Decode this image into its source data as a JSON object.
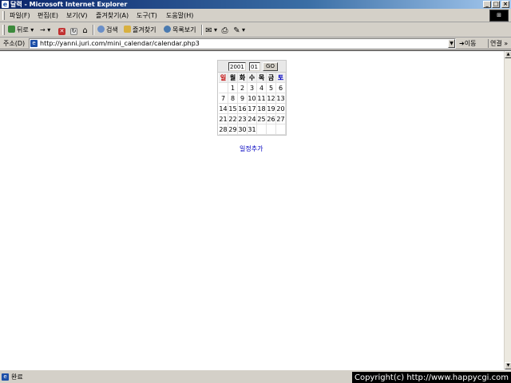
{
  "window": {
    "title": "달력 - Microsoft Internet Explorer",
    "icon": "ie-icon",
    "controls": {
      "minimize": "_",
      "maximize": "□",
      "close": "×"
    }
  },
  "menu": {
    "items": [
      "파일(F)",
      "편집(E)",
      "보기(V)",
      "즐겨찾기(A)",
      "도구(T)",
      "도움말(H)"
    ]
  },
  "toolbar": {
    "back": "뒤로",
    "forward": "→",
    "stop": "✕",
    "refresh": "↻",
    "home": "⌂",
    "search": "검색",
    "favorites": "즐겨찾기",
    "history": "목록보기",
    "mail": "✉",
    "print": "⎙",
    "edit": "✎"
  },
  "address": {
    "label": "주소(D)",
    "url": "http://yanni.juri.com/mini_calendar/calendar.php3",
    "go_label": "이동",
    "links_label": "연결 »"
  },
  "calendar": {
    "year": "2001",
    "month": "01",
    "go_label": "GO",
    "weekdays": [
      "일",
      "월",
      "화",
      "수",
      "목",
      "금",
      "토"
    ],
    "weeks": [
      [
        "",
        "1",
        "2",
        "3",
        "4",
        "5",
        "6"
      ],
      [
        "7",
        "8",
        "9",
        "10",
        "11",
        "12",
        "13"
      ],
      [
        "14",
        "15",
        "16",
        "17",
        "18",
        "19",
        "20"
      ],
      [
        "21",
        "22",
        "23",
        "24",
        "25",
        "26",
        "27"
      ],
      [
        "28",
        "29",
        "30",
        "31",
        "",
        "",
        ""
      ]
    ],
    "colors": {
      "sunday": "#c00000",
      "saturday": "#0000c0"
    }
  },
  "add_schedule_link": "일정추가",
  "status": {
    "text": "완료",
    "copyright": "Copyright(c) http://www.happycgi.com"
  }
}
